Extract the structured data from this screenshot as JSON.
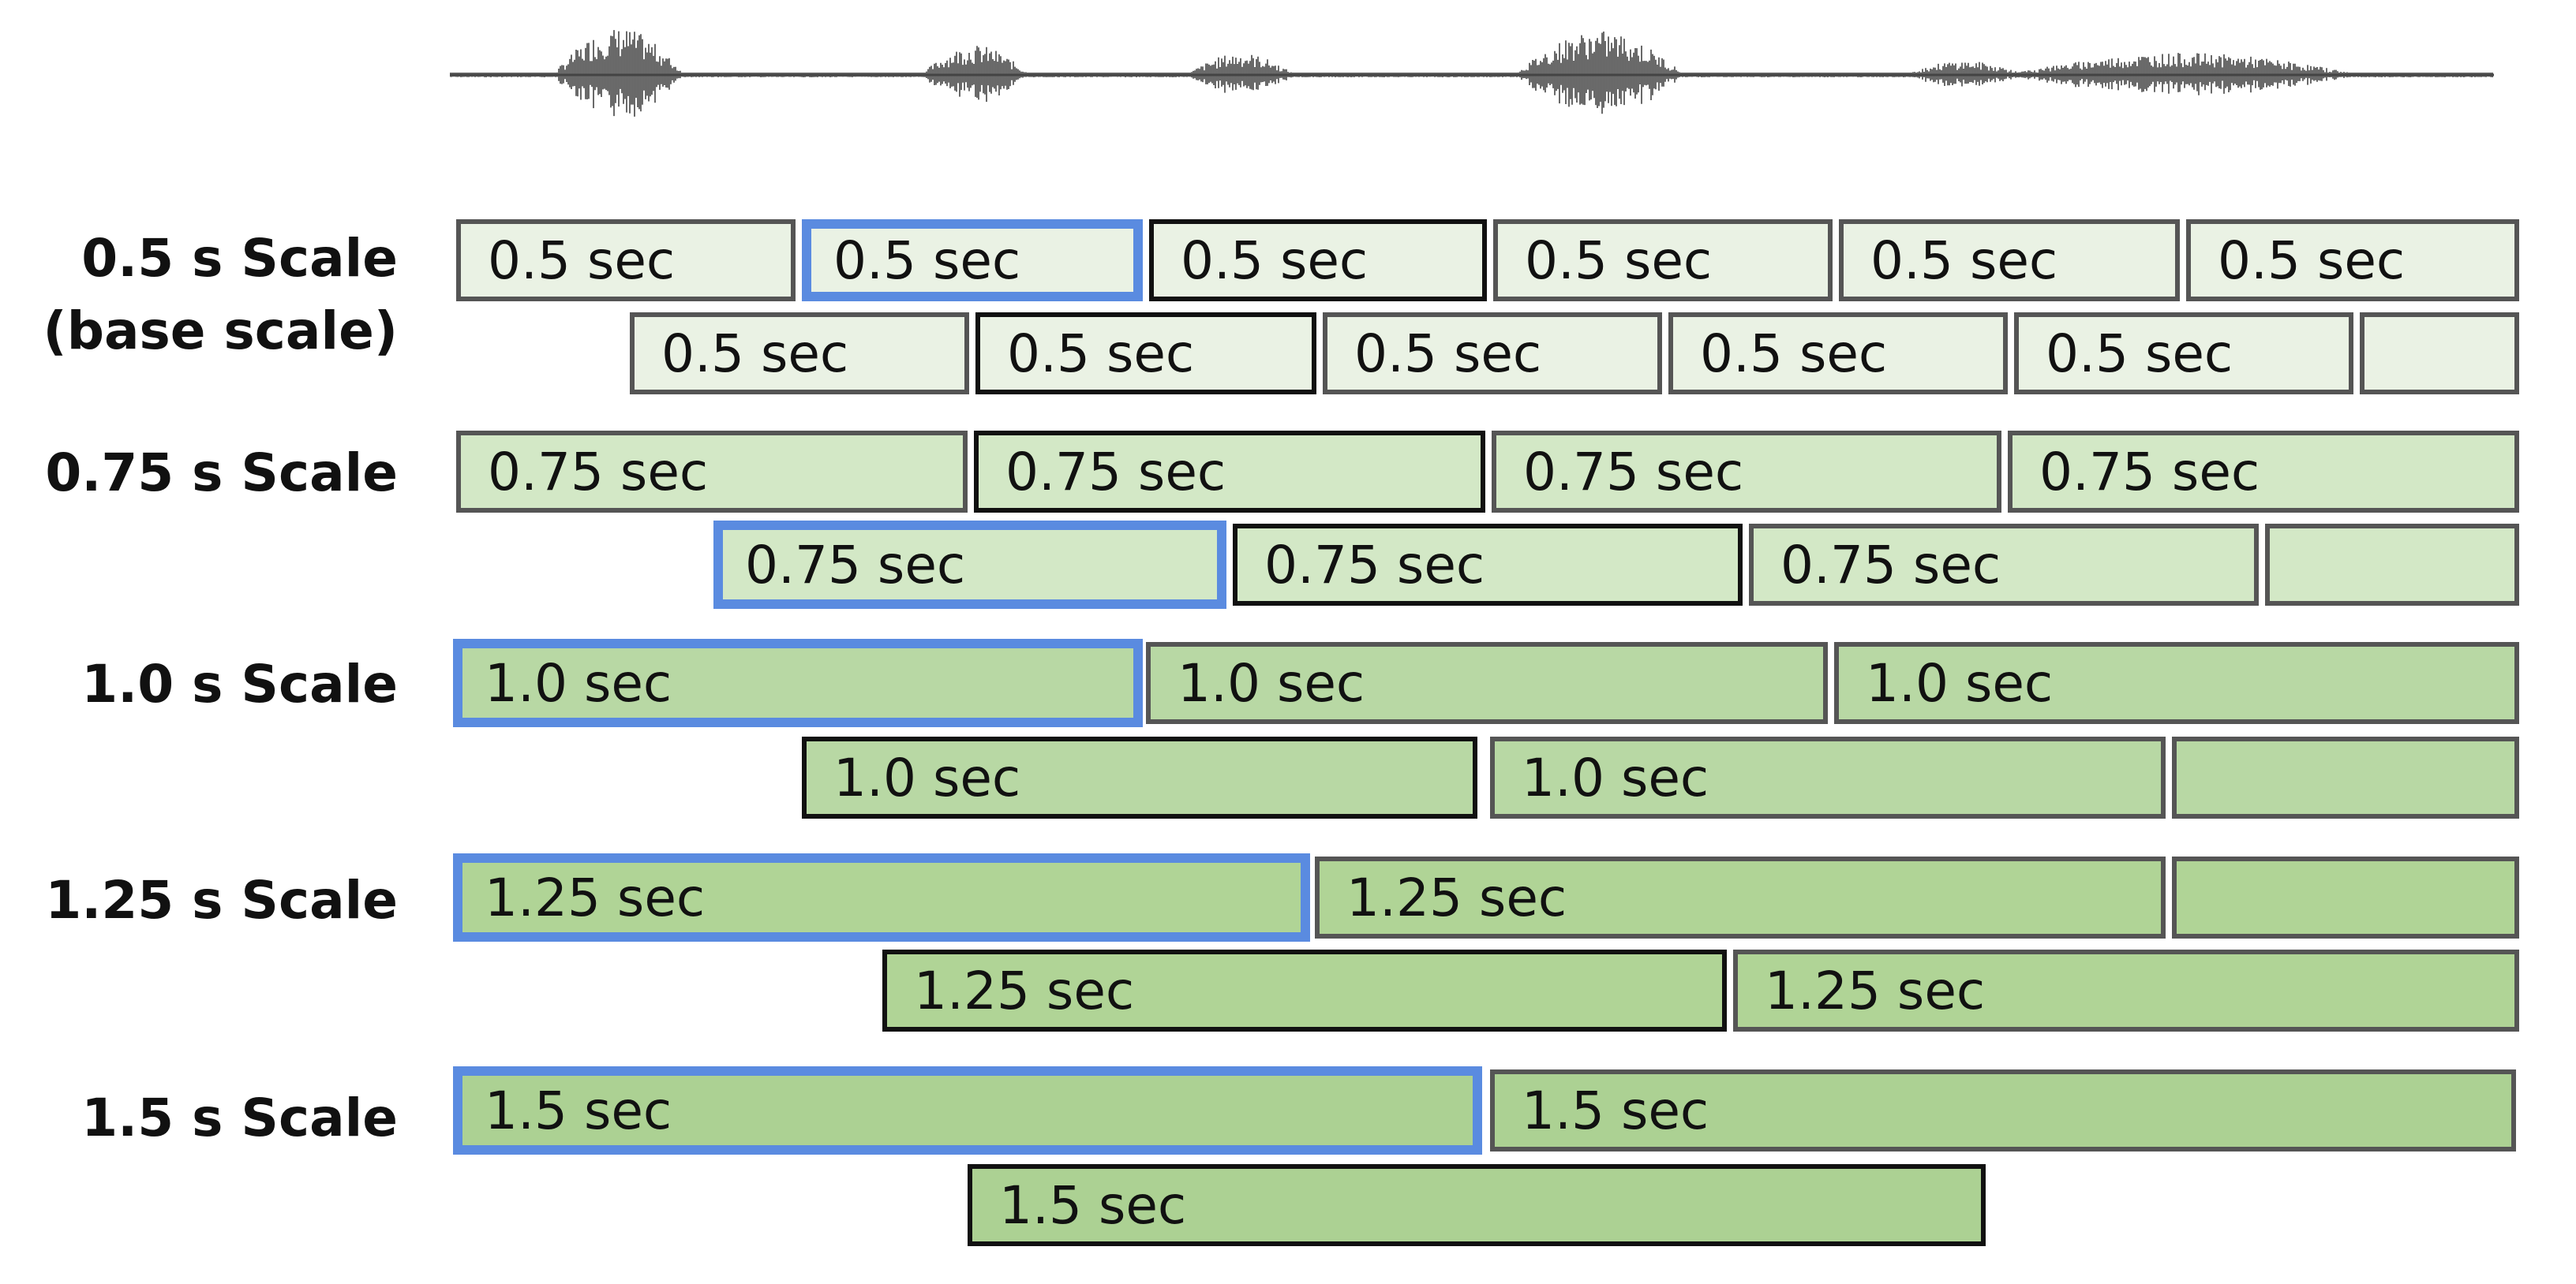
{
  "waveform": {
    "icon": "audio-waveform-icon"
  },
  "scales": [
    {
      "id": "0-5",
      "label_lines": [
        "0.5 s Scale",
        "(base scale)"
      ],
      "fill": "#eaf2e4",
      "row1": [
        "0.5 sec",
        "0.5 sec",
        "0.5 sec",
        "0.5 sec",
        "0.5 sec",
        "0.5 sec"
      ],
      "row2": [
        "0.5 sec",
        "0.5 sec",
        "0.5 sec",
        "0.5 sec",
        "0.5 sec",
        ""
      ],
      "highlighted": "row1-1"
    },
    {
      "id": "0-75",
      "label_lines": [
        "0.75 s Scale"
      ],
      "fill": "#d3e8c6",
      "row1": [
        "0.75 sec",
        "0.75 sec",
        "0.75 sec",
        "0.75 sec"
      ],
      "row2": [
        "0.75 sec",
        "0.75 sec",
        "0.75 sec",
        ""
      ],
      "highlighted": "row2-0"
    },
    {
      "id": "1-0",
      "label_lines": [
        "1.0 s Scale"
      ],
      "fill": "#b8d8a4",
      "row1": [
        "1.0 sec",
        "1.0 sec",
        "1.0 sec"
      ],
      "row2": [
        "1.0 sec",
        "1.0 sec",
        ""
      ],
      "highlighted": "row1-0"
    },
    {
      "id": "1-25",
      "label_lines": [
        "1.25 s Scale"
      ],
      "fill": "#b0d496",
      "row1": [
        "1.25 sec",
        "1.25 sec",
        ""
      ],
      "row2": [
        "1.25 sec",
        "1.25 sec"
      ],
      "highlighted": "row1-0"
    },
    {
      "id": "1-5",
      "label_lines": [
        "1.5 s Scale"
      ],
      "fill": "#acd193",
      "row1": [
        "1.5 sec",
        "1.5 sec"
      ],
      "row2": [
        "1.5 sec"
      ],
      "highlighted": "row1-0"
    }
  ],
  "colors": {
    "highlight_border": "#5a8be0",
    "dark_border": "#111111",
    "normal_border": "#555555",
    "waveform": "#444444"
  }
}
